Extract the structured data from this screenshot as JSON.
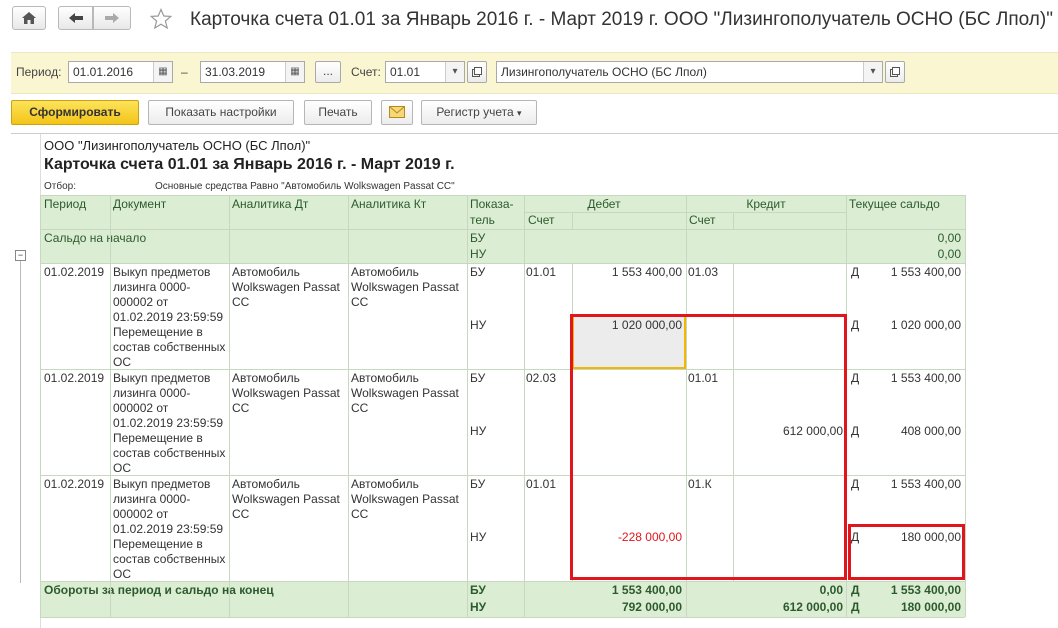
{
  "window": {
    "title": "Карточка счета 01.01 за Январь 2016 г. - Март 2019 г. ООО \"Лизингополучатель ОСНО (БС Лпол)\"",
    "home_icon": "home-icon",
    "back_icon": "arrow-left-icon",
    "forward_icon": "arrow-right-icon",
    "star_icon": "star-icon"
  },
  "params": {
    "period_label": "Период:",
    "date_from": "01.01.2016",
    "dash": "–",
    "date_to": "31.03.2019",
    "ellipsis": "...",
    "account_label": "Счет:",
    "account": "01.01",
    "organization": "Лизингополучатель ОСНО (БС Лпол)"
  },
  "toolbar": {
    "generate": "Сформировать",
    "show_settings": "Показать настройки",
    "print": "Печать",
    "register": "Регистр учета"
  },
  "report": {
    "org": "ООО \"Лизингополучатель ОСНО (БС Лпол)\"",
    "title": "Карточка счета 01.01 за Январь 2016 г. - Март 2019 г.",
    "filter_label": "Отбор:",
    "filter_value": "Основные средства Равно \"Автомобиль Wolkswagen Passat CC\"",
    "headers": {
      "period": "Период",
      "document": "Документ",
      "analytics_dt": "Аналитика Дт",
      "analytics_kt": "Аналитика Кт",
      "indicator1": "Показа-",
      "indicator2": "тель",
      "debit": "Дебет",
      "credit": "Кредит",
      "balance": "Текущее сальдо",
      "account_dt": "Счет",
      "account_kt": "Счет"
    },
    "opening": {
      "label": "Сальдо на начало",
      "bu": "БУ",
      "nu": "НУ",
      "bu_value": "0,00",
      "nu_value": "0,00"
    },
    "rows": [
      {
        "period": "01.02.2019",
        "document": "Выкуп предметов лизинга 0000-000002 от 01.02.2019 23:59:59 Перемещение в состав собственных ОС",
        "analytics_dt": "Автомобиль Wolkswagen Passat CC",
        "analytics_kt": "Автомобиль Wolkswagen Passat CC",
        "bu": "БУ",
        "nu": "НУ",
        "dt_account": "01.01",
        "dt_bu": "1 553 400,00",
        "dt_nu": "1 020 000,00",
        "kt_account": "01.03",
        "kt_bu": "",
        "kt_nu": "",
        "bal_bu_side": "Д",
        "bal_bu": "1 553 400,00",
        "bal_nu_side": "Д",
        "bal_nu": "1 020 000,00"
      },
      {
        "period": "01.02.2019",
        "document": "Выкуп предметов лизинга 0000-000002 от 01.02.2019 23:59:59 Перемещение в состав собственных ОС",
        "analytics_dt": "Автомобиль Wolkswagen Passat CC",
        "analytics_kt": "Автомобиль Wolkswagen Passat CC",
        "bu": "БУ",
        "nu": "НУ",
        "dt_account": "02.03",
        "dt_bu": "",
        "dt_nu": "",
        "kt_account": "01.01",
        "kt_bu": "",
        "kt_nu": "612 000,00",
        "bal_bu_side": "Д",
        "bal_bu": "1 553 400,00",
        "bal_nu_side": "Д",
        "bal_nu": "408 000,00"
      },
      {
        "period": "01.02.2019",
        "document": "Выкуп предметов лизинга 0000-000002 от 01.02.2019 23:59:59 Перемещение в состав собственных ОС",
        "analytics_dt": "Автомобиль Wolkswagen Passat CC",
        "analytics_kt": "Автомобиль Wolkswagen Passat CC",
        "bu": "БУ",
        "nu": "НУ",
        "dt_account": "01.01",
        "dt_bu": "",
        "dt_nu": "-228 000,00",
        "kt_account": "01.К",
        "kt_bu": "",
        "kt_nu": "",
        "bal_bu_side": "Д",
        "bal_bu": "1 553 400,00",
        "bal_nu_side": "Д",
        "bal_nu": "180 000,00"
      }
    ],
    "totals": {
      "label": "Обороты за период и сальдо на конец",
      "bu": "БУ",
      "nu": "НУ",
      "dt_bu": "1 553 400,00",
      "dt_nu": "792 000,00",
      "kt_bu": "0,00",
      "kt_nu": "612 000,00",
      "bal_bu_side": "Д",
      "bal_bu": "1 553 400,00",
      "bal_nu_side": "Д",
      "bal_nu": "180 000,00"
    },
    "colors": {
      "header_bg": "#dbeed3",
      "highlight_red": "#e0161c",
      "negative_red": "#e0161c",
      "selected_cell": "#ececec",
      "selected_border": "#f2b700"
    }
  }
}
